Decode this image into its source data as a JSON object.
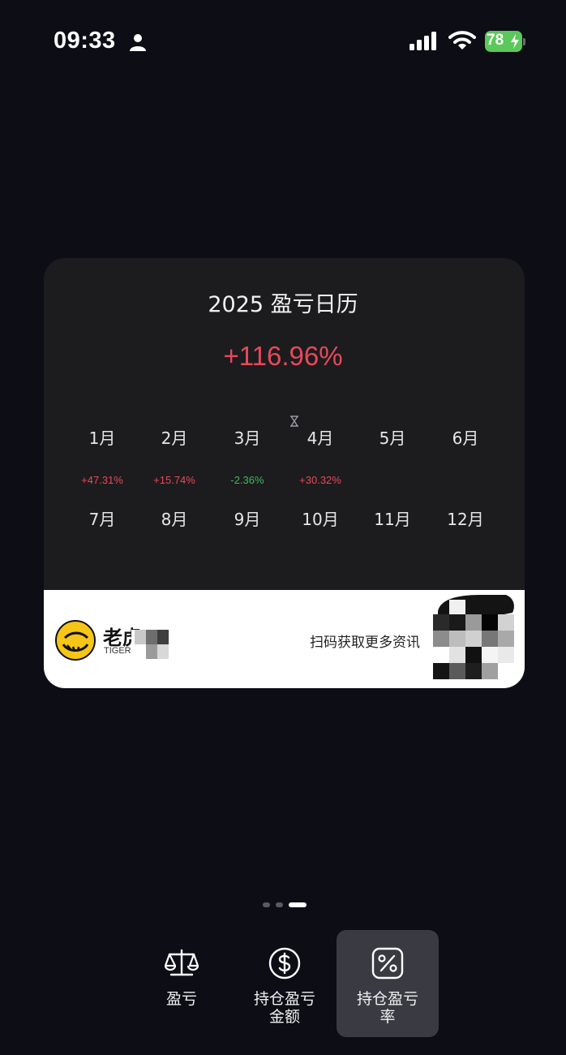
{
  "status_bar": {
    "time": "09:33",
    "battery": "78",
    "icons": [
      "person-icon",
      "signal-icon",
      "wifi-icon",
      "battery-charging-icon"
    ]
  },
  "card": {
    "title": "2025 盈亏日历",
    "total_return": "+116.96%",
    "months": [
      {
        "label": "1月",
        "value": "+47.31%",
        "tone": "positive"
      },
      {
        "label": "2月",
        "value": "+15.74%",
        "tone": "positive"
      },
      {
        "label": "3月",
        "value": "-2.36%",
        "tone": "negative"
      },
      {
        "label": "4月",
        "value": "+30.32%",
        "tone": "positive"
      },
      {
        "label": "5月",
        "value": "",
        "tone": ""
      },
      {
        "label": "6月",
        "value": "",
        "tone": ""
      },
      {
        "label": "7月",
        "value": "",
        "tone": ""
      },
      {
        "label": "8月",
        "value": "",
        "tone": ""
      },
      {
        "label": "9月",
        "value": "",
        "tone": ""
      },
      {
        "label": "10月",
        "value": "",
        "tone": ""
      },
      {
        "label": "11月",
        "value": "",
        "tone": ""
      },
      {
        "label": "12月",
        "value": "",
        "tone": ""
      }
    ],
    "footer": {
      "brand_cn": "老虎",
      "brand_en": "TIGER B",
      "scan_text": "扫码获取更多资讯"
    }
  },
  "pager": {
    "count": 3,
    "active_index": 2
  },
  "tabs": [
    {
      "label_line1": "盈亏",
      "label_line2": "",
      "icon": "balance-scale-icon",
      "active": false
    },
    {
      "label_line1": "持仓盈亏",
      "label_line2": "金额",
      "icon": "dollar-circle-icon",
      "active": false
    },
    {
      "label_line1": "持仓盈亏",
      "label_line2": "率",
      "icon": "percent-square-icon",
      "active": true
    }
  ],
  "colors": {
    "background": "#0d0d15",
    "card": "#1c1c1e",
    "positive": "#e8495a",
    "negative": "#3fb95c",
    "battery": "#5ac85a",
    "active_tab": "#3a3a42"
  }
}
